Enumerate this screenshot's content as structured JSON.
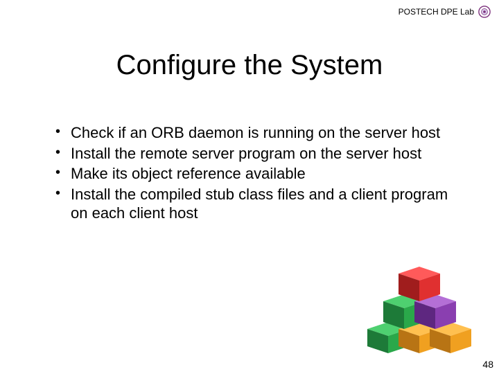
{
  "header": {
    "lab_label": "POSTECH DPE Lab",
    "logo_icon": "university-seal-icon"
  },
  "title": "Configure the System",
  "bullets": [
    "Check if an ORB daemon is running on the server host",
    "Install the remote server program on the server host",
    "Make its object reference available",
    "Install the compiled stub class files and a client program on each client host"
  ],
  "page_number": "48",
  "graphic": {
    "description": "stacked-cubes-pyramid",
    "cube_colors": {
      "top": "#e03030",
      "mid_left": "#2aa84a",
      "mid_right": "#8a3fb0",
      "bot_left": "#2aa84a",
      "bot_mid": "#f0a020",
      "bot_right": "#f0a020"
    }
  }
}
